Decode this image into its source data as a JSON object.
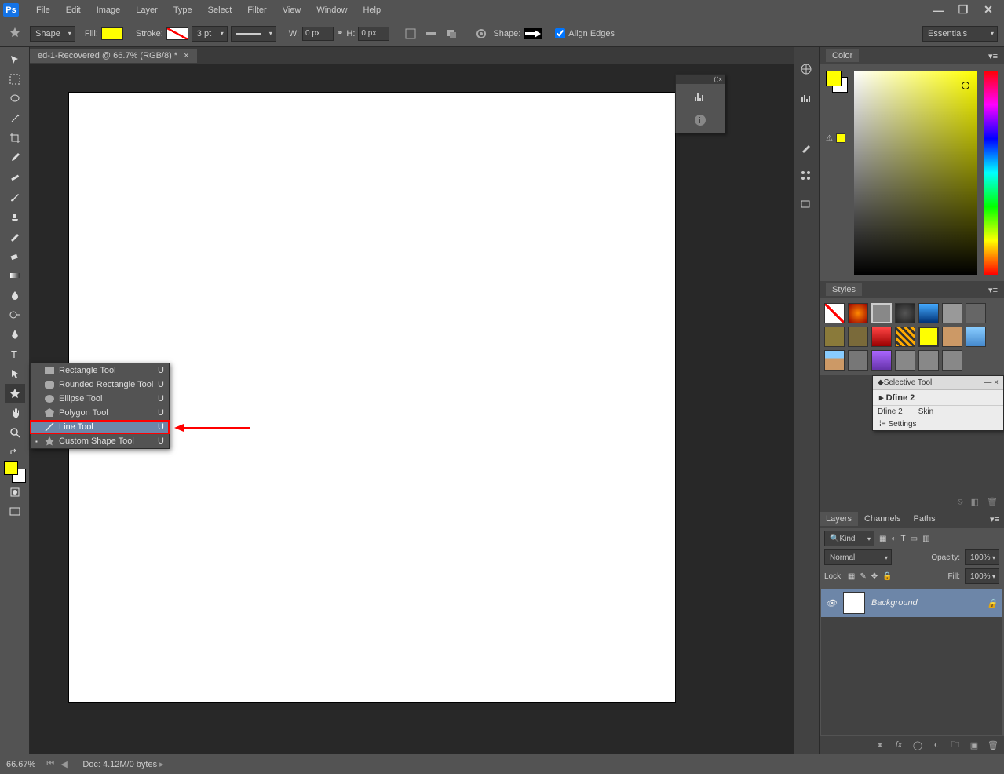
{
  "app": {
    "logo": "Ps"
  },
  "menubar": [
    "File",
    "Edit",
    "Image",
    "Layer",
    "Type",
    "Select",
    "Filter",
    "View",
    "Window",
    "Help"
  ],
  "optionsbar": {
    "mode": "Shape",
    "fill_label": "Fill:",
    "stroke_label": "Stroke:",
    "stroke_weight": "3 pt",
    "w_label": "W:",
    "w_value": "0 px",
    "h_label": "H:",
    "h_value": "0 px",
    "shape_label": "Shape:",
    "align_edges": "Align Edges",
    "workspace": "Essentials"
  },
  "document": {
    "tab_title": "ed-1-Recovered @ 66.7% (RGB/8) *"
  },
  "flyout": {
    "items": [
      {
        "label": "Rectangle Tool",
        "key": "U",
        "selected": false
      },
      {
        "label": "Rounded Rectangle Tool",
        "key": "U",
        "selected": false
      },
      {
        "label": "Ellipse Tool",
        "key": "U",
        "selected": false
      },
      {
        "label": "Polygon Tool",
        "key": "U",
        "selected": false
      },
      {
        "label": "Line Tool",
        "key": "U",
        "selected": true
      },
      {
        "label": "Custom Shape Tool",
        "key": "U",
        "selected": false,
        "current": true
      }
    ]
  },
  "panels": {
    "color_tab": "Color",
    "styles_tab": "Styles",
    "layers_tabs": [
      "Layers",
      "Channels",
      "Paths"
    ],
    "kind": "Kind",
    "blend_mode": "Normal",
    "opacity_label": "Opacity:",
    "opacity_value": "100%",
    "lock_label": "Lock:",
    "fill_label": "Fill:",
    "fill_value": "100%",
    "bg_layer": "Background"
  },
  "selective": {
    "title": "Selective Tool",
    "row1": "Dfine 2",
    "row2a": "Dfine 2",
    "row2b": "Skin",
    "settings": "Settings"
  },
  "status": {
    "zoom": "66.67%",
    "docinfo": "Doc: 4.12M/0 bytes"
  },
  "colors": {
    "fill": "#ffff00",
    "accent_highlight": "#6d86a8"
  }
}
